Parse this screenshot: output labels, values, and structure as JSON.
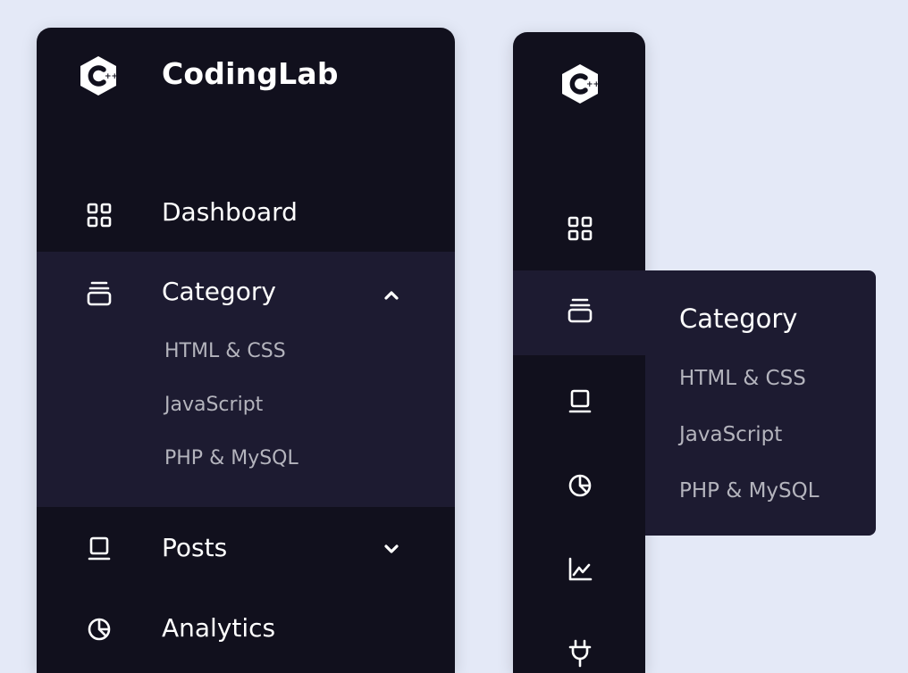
{
  "brand": {
    "name": "CodingLab",
    "logo_icon": "c-plus-hex-logo-icon"
  },
  "colors": {
    "background": "#e4e9f7",
    "sidebar": "#11101d",
    "active": "#1d1b31",
    "text": "#ffffff",
    "muted": "#b4b4bd"
  },
  "expanded_sidebar": {
    "items": [
      {
        "label": "Dashboard",
        "icon": "grid-icon"
      },
      {
        "label": "Category",
        "icon": "collection-icon",
        "chevron": "chevron-up-icon",
        "sublinks": [
          "HTML & CSS",
          "JavaScript",
          "PHP & MySQL"
        ]
      },
      {
        "label": "Posts",
        "icon": "book-icon",
        "chevron": "chevron-down-icon"
      },
      {
        "label": "Analytics",
        "icon": "pie-chart-icon"
      }
    ]
  },
  "collapsed_sidebar": {
    "icons": [
      "grid-icon",
      "collection-icon",
      "book-icon",
      "pie-chart-icon",
      "line-chart-icon",
      "plug-icon"
    ],
    "flyout": {
      "title": "Category",
      "sublinks": [
        "HTML & CSS",
        "JavaScript",
        "PHP & MySQL"
      ]
    }
  }
}
